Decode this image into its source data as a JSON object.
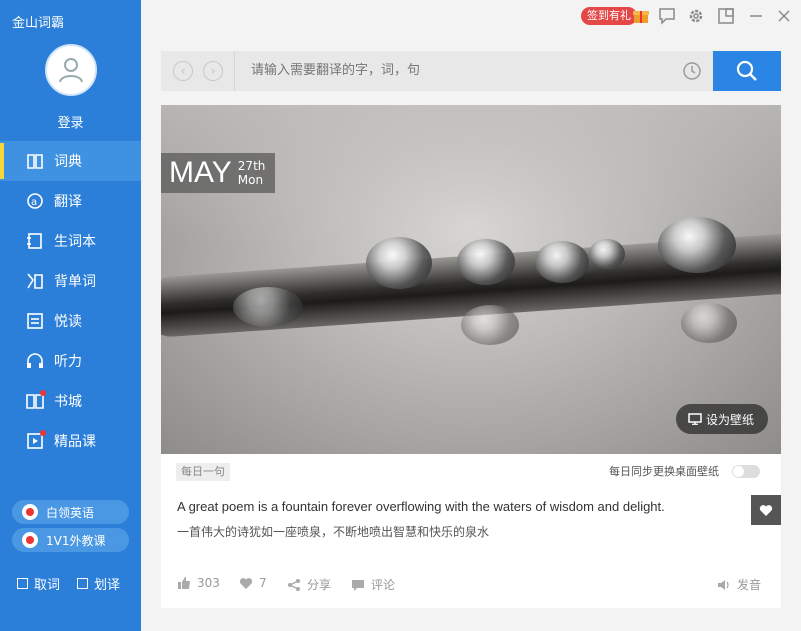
{
  "app": {
    "title": "金山词霸",
    "login_label": "登录"
  },
  "sidebar": {
    "items": [
      {
        "label": "词典",
        "icon": "book-icon",
        "active": true
      },
      {
        "label": "翻译",
        "icon": "translate-icon",
        "active": false
      },
      {
        "label": "生词本",
        "icon": "notebook-icon",
        "active": false
      },
      {
        "label": "背单词",
        "icon": "memorize-icon",
        "active": false
      },
      {
        "label": "悦读",
        "icon": "reading-icon",
        "active": false
      },
      {
        "label": "听力",
        "icon": "headphones-icon",
        "active": false
      },
      {
        "label": "书城",
        "icon": "bookstore-icon",
        "active": false,
        "dot": true
      },
      {
        "label": "精品课",
        "icon": "course-icon",
        "active": false,
        "dot": true
      }
    ],
    "promos": [
      {
        "label": "白领英语"
      },
      {
        "label": "1V1外教课"
      }
    ],
    "checks": [
      {
        "label": "取词"
      },
      {
        "label": "划译"
      }
    ],
    "colors": {
      "bg": "#2b7fd8",
      "active_bg": "#3f91e2",
      "active_bar": "#f7d83a"
    }
  },
  "titlebar": {
    "signin_badge": "签到有礼",
    "icons": [
      "gift-icon",
      "feedback-icon",
      "settings-icon",
      "minimode-icon",
      "minimize-icon",
      "close-icon"
    ]
  },
  "search": {
    "placeholder": "请输入需要翻译的字，词，句"
  },
  "daily": {
    "month": "MAY",
    "day": "27th",
    "weekday": "Mon",
    "wallpaper_button": "设为壁纸",
    "tag": "每日一句",
    "sync_label": "每日同步更换桌面壁纸",
    "sync_enabled": false,
    "quote_en": "A great poem is a fountain forever overflowing with the waters of wisdom and delight.",
    "quote_zh": "一首伟大的诗犹如一座喷泉，不断地喷出智慧和快乐的泉水",
    "likes": "303",
    "hearts": "7",
    "share": "分享",
    "comment": "评论",
    "pronounce": "发音"
  }
}
